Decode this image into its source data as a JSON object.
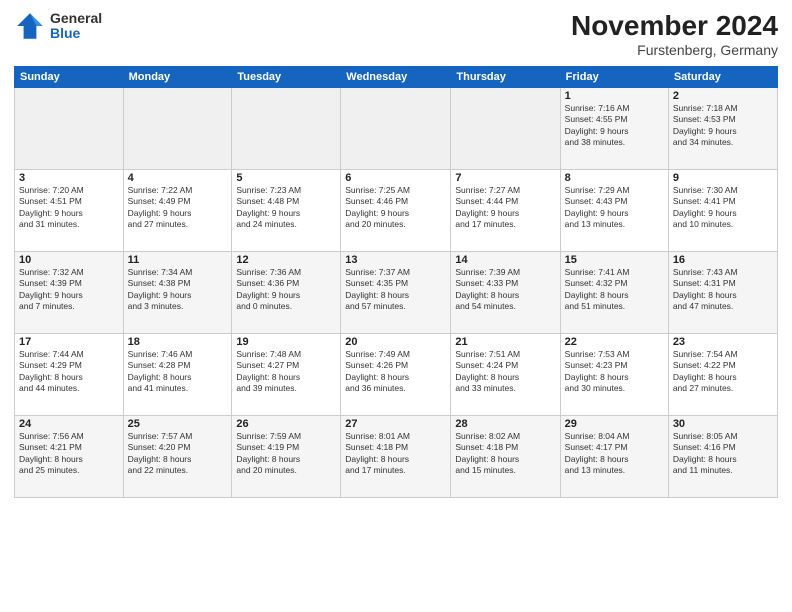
{
  "logo": {
    "general": "General",
    "blue": "Blue"
  },
  "header": {
    "title": "November 2024",
    "location": "Furstenberg, Germany"
  },
  "weekdays": [
    "Sunday",
    "Monday",
    "Tuesday",
    "Wednesday",
    "Thursday",
    "Friday",
    "Saturday"
  ],
  "weeks": [
    [
      {
        "day": "",
        "info": ""
      },
      {
        "day": "",
        "info": ""
      },
      {
        "day": "",
        "info": ""
      },
      {
        "day": "",
        "info": ""
      },
      {
        "day": "",
        "info": ""
      },
      {
        "day": "1",
        "info": "Sunrise: 7:16 AM\nSunset: 4:55 PM\nDaylight: 9 hours\nand 38 minutes."
      },
      {
        "day": "2",
        "info": "Sunrise: 7:18 AM\nSunset: 4:53 PM\nDaylight: 9 hours\nand 34 minutes."
      }
    ],
    [
      {
        "day": "3",
        "info": "Sunrise: 7:20 AM\nSunset: 4:51 PM\nDaylight: 9 hours\nand 31 minutes."
      },
      {
        "day": "4",
        "info": "Sunrise: 7:22 AM\nSunset: 4:49 PM\nDaylight: 9 hours\nand 27 minutes."
      },
      {
        "day": "5",
        "info": "Sunrise: 7:23 AM\nSunset: 4:48 PM\nDaylight: 9 hours\nand 24 minutes."
      },
      {
        "day": "6",
        "info": "Sunrise: 7:25 AM\nSunset: 4:46 PM\nDaylight: 9 hours\nand 20 minutes."
      },
      {
        "day": "7",
        "info": "Sunrise: 7:27 AM\nSunset: 4:44 PM\nDaylight: 9 hours\nand 17 minutes."
      },
      {
        "day": "8",
        "info": "Sunrise: 7:29 AM\nSunset: 4:43 PM\nDaylight: 9 hours\nand 13 minutes."
      },
      {
        "day": "9",
        "info": "Sunrise: 7:30 AM\nSunset: 4:41 PM\nDaylight: 9 hours\nand 10 minutes."
      }
    ],
    [
      {
        "day": "10",
        "info": "Sunrise: 7:32 AM\nSunset: 4:39 PM\nDaylight: 9 hours\nand 7 minutes."
      },
      {
        "day": "11",
        "info": "Sunrise: 7:34 AM\nSunset: 4:38 PM\nDaylight: 9 hours\nand 3 minutes."
      },
      {
        "day": "12",
        "info": "Sunrise: 7:36 AM\nSunset: 4:36 PM\nDaylight: 9 hours\nand 0 minutes."
      },
      {
        "day": "13",
        "info": "Sunrise: 7:37 AM\nSunset: 4:35 PM\nDaylight: 8 hours\nand 57 minutes."
      },
      {
        "day": "14",
        "info": "Sunrise: 7:39 AM\nSunset: 4:33 PM\nDaylight: 8 hours\nand 54 minutes."
      },
      {
        "day": "15",
        "info": "Sunrise: 7:41 AM\nSunset: 4:32 PM\nDaylight: 8 hours\nand 51 minutes."
      },
      {
        "day": "16",
        "info": "Sunrise: 7:43 AM\nSunset: 4:31 PM\nDaylight: 8 hours\nand 47 minutes."
      }
    ],
    [
      {
        "day": "17",
        "info": "Sunrise: 7:44 AM\nSunset: 4:29 PM\nDaylight: 8 hours\nand 44 minutes."
      },
      {
        "day": "18",
        "info": "Sunrise: 7:46 AM\nSunset: 4:28 PM\nDaylight: 8 hours\nand 41 minutes."
      },
      {
        "day": "19",
        "info": "Sunrise: 7:48 AM\nSunset: 4:27 PM\nDaylight: 8 hours\nand 39 minutes."
      },
      {
        "day": "20",
        "info": "Sunrise: 7:49 AM\nSunset: 4:26 PM\nDaylight: 8 hours\nand 36 minutes."
      },
      {
        "day": "21",
        "info": "Sunrise: 7:51 AM\nSunset: 4:24 PM\nDaylight: 8 hours\nand 33 minutes."
      },
      {
        "day": "22",
        "info": "Sunrise: 7:53 AM\nSunset: 4:23 PM\nDaylight: 8 hours\nand 30 minutes."
      },
      {
        "day": "23",
        "info": "Sunrise: 7:54 AM\nSunset: 4:22 PM\nDaylight: 8 hours\nand 27 minutes."
      }
    ],
    [
      {
        "day": "24",
        "info": "Sunrise: 7:56 AM\nSunset: 4:21 PM\nDaylight: 8 hours\nand 25 minutes."
      },
      {
        "day": "25",
        "info": "Sunrise: 7:57 AM\nSunset: 4:20 PM\nDaylight: 8 hours\nand 22 minutes."
      },
      {
        "day": "26",
        "info": "Sunrise: 7:59 AM\nSunset: 4:19 PM\nDaylight: 8 hours\nand 20 minutes."
      },
      {
        "day": "27",
        "info": "Sunrise: 8:01 AM\nSunset: 4:18 PM\nDaylight: 8 hours\nand 17 minutes."
      },
      {
        "day": "28",
        "info": "Sunrise: 8:02 AM\nSunset: 4:18 PM\nDaylight: 8 hours\nand 15 minutes."
      },
      {
        "day": "29",
        "info": "Sunrise: 8:04 AM\nSunset: 4:17 PM\nDaylight: 8 hours\nand 13 minutes."
      },
      {
        "day": "30",
        "info": "Sunrise: 8:05 AM\nSunset: 4:16 PM\nDaylight: 8 hours\nand 11 minutes."
      }
    ]
  ]
}
